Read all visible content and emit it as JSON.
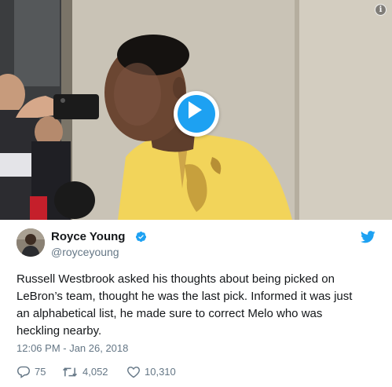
{
  "media": {
    "info_label": "i",
    "play_label": "Play video"
  },
  "author": {
    "display_name": "Royce Young",
    "handle": "@royceyoung",
    "verified": true
  },
  "tweet": {
    "text_lines": [
      "Russell Westbrook asked his thoughts about being picked on",
      "LeBron’s team, thought he was the last pick. Informed it was just",
      "an alphabetical list, he made sure to correct Melo who was",
      "heckling nearby."
    ],
    "timestamp": "12:06 PM - Jan 26, 2018"
  },
  "actions": {
    "replies": "75",
    "retweets": "4,052",
    "likes": "10,310"
  },
  "colors": {
    "brand_blue": "#1da1f2",
    "text_primary": "#14171a",
    "text_secondary": "#657786"
  },
  "icons": {
    "play": "play-icon",
    "info": "info-icon",
    "verified": "verified-badge-icon",
    "bird": "twitter-bird-icon",
    "reply": "reply-icon",
    "retweet": "retweet-icon",
    "like": "heart-icon"
  }
}
